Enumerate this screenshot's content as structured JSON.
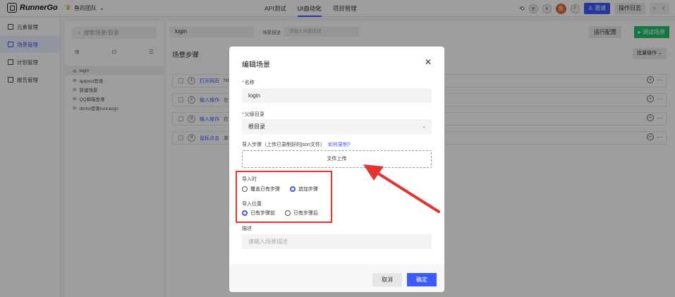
{
  "app": {
    "logo": "RunnerGo",
    "team": "鱼的团队"
  },
  "nav": [
    "API测试",
    "UI自动化",
    "项目管理"
  ],
  "nav_active_index": 1,
  "topbar": {
    "avatar_initial": "鱼",
    "invite": "邀请",
    "log": "操作日志",
    "circle_a": "赏",
    "circle_b": "⊛",
    "count": "0"
  },
  "leftnav": [
    "元素管理",
    "场景管理",
    "计划管理",
    "报告管理"
  ],
  "leftnav_active_index": 1,
  "tree": {
    "search_placeholder": "搜索场景/目录",
    "items": [
      "login",
      "apipost登录",
      "新建场景",
      "QQ邮箱登录",
      "demo登录runnergo"
    ]
  },
  "main": {
    "scene_name": "login",
    "desc_label": "场景描述",
    "desc_placeholder": "请输入场景描述",
    "run_config": "运行配置",
    "debug": "调试场景",
    "steps_title": "场景步骤",
    "batch": "批量操作",
    "steps": [
      {
        "num": "1",
        "type": "打开网页",
        "extra": "htt"
      },
      {
        "num": "2",
        "type": "输入操作",
        "extra": "在"
      },
      {
        "num": "3",
        "type": "输入操作",
        "extra": "在"
      },
      {
        "num": "4",
        "type": "鼠标点击",
        "extra": "单"
      }
    ]
  },
  "modal": {
    "title": "编辑场景",
    "name_label": "名称",
    "name_value": "login",
    "parent_label": "父级目录",
    "parent_value": "根目录",
    "import_label": "导入步骤（上传已录制好的json文件）",
    "import_link": "如何录制?",
    "upload": "文件上传",
    "import_when_label": "导入时",
    "import_when_options": [
      "覆盖已有步骤",
      "追加步骤"
    ],
    "import_when_selected": 1,
    "position_label": "导入位置",
    "position_options": [
      "已有步骤前",
      "已有步骤后"
    ],
    "position_selected": 0,
    "desc_label": "描述",
    "desc_placeholder": "请输入场景描述",
    "cancel": "取消",
    "ok": "确定"
  },
  "colors": {
    "primary": "#3d5afe",
    "success": "#21c16b",
    "annotation": "#e33333"
  }
}
